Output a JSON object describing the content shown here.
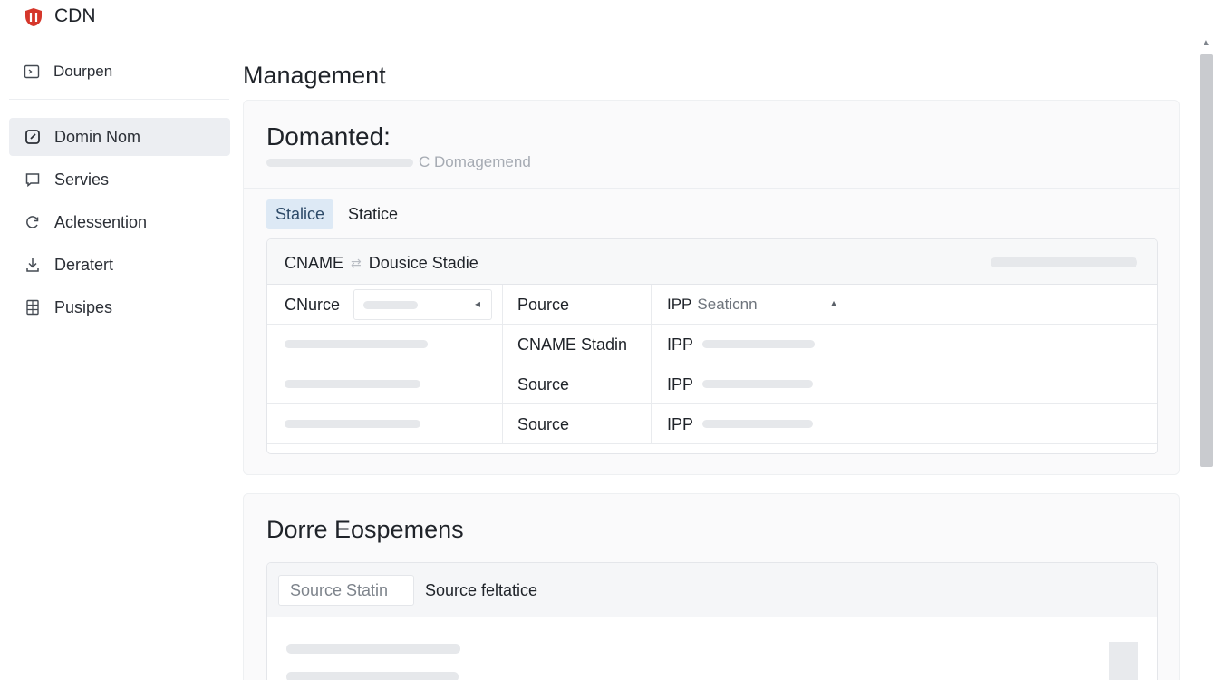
{
  "app": {
    "title": "CDN",
    "logo_icon": "shield-logo",
    "brand_color": "#d5372b"
  },
  "sidebar": {
    "top_item": {
      "label": "Dourpen",
      "icon": "terminal-icon"
    },
    "items": [
      {
        "label": "Domin Nom",
        "icon": "edit-square-icon",
        "active": true
      },
      {
        "label": "Servies",
        "icon": "chat-icon",
        "active": false
      },
      {
        "label": "Aclessention",
        "icon": "refresh-icon",
        "active": false
      },
      {
        "label": "Deratert",
        "icon": "download-icon",
        "active": false
      },
      {
        "label": "Pusipes",
        "icon": "grid-doc-icon",
        "active": false
      }
    ]
  },
  "main": {
    "page_title": "Management",
    "card1": {
      "title": "Domanted:",
      "subtitle": "C Domagemend",
      "tabs": [
        {
          "label": "Stalice",
          "active": true
        },
        {
          "label": "Statice",
          "active": false
        }
      ],
      "panel": {
        "header_label": "CNAME",
        "header_sub": "Dousice Stadie",
        "rows": [
          {
            "c1_select": "CNurce",
            "c2": "Pource",
            "c3_label": "IPP",
            "c3_select": "Seaticnn"
          },
          {
            "c2": "CNAME Stadin",
            "c3_label": "IPP"
          },
          {
            "c2": "Source",
            "c3_label": "IPP"
          },
          {
            "c2": "Source",
            "c3_label": "IPP"
          }
        ]
      }
    },
    "card2": {
      "title": "Dorre Eospemens",
      "input_value": "Source Statin",
      "label": "Source feltatice"
    }
  },
  "colors": {
    "accent_tab_bg": "#dde9f5",
    "active_nav_bg": "#eceef2"
  }
}
